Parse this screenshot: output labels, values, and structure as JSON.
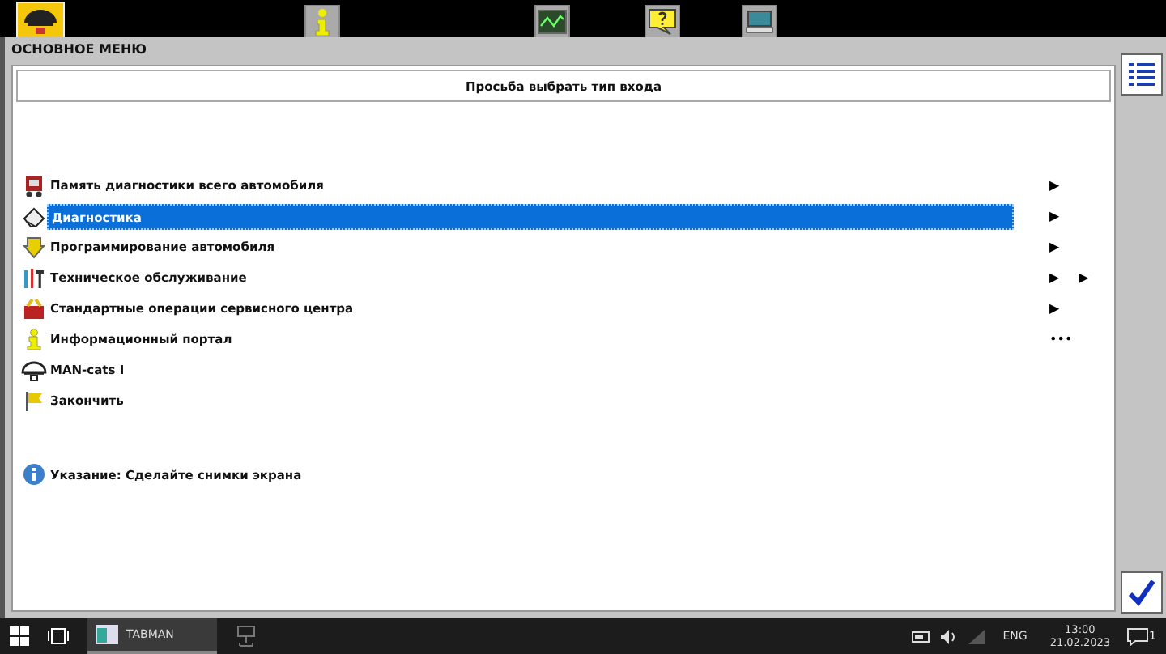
{
  "tabs": [
    {
      "kind": "home",
      "selected": true
    },
    {
      "kind": "info",
      "selected": false
    },
    {
      "kind": "chart",
      "selected": false
    },
    {
      "kind": "help",
      "selected": false
    },
    {
      "kind": "computer",
      "selected": false
    }
  ],
  "screen_title": "ОСНОВНОЕ МЕНЮ",
  "prompt": "Просьба выбрать тип входа",
  "menu": [
    {
      "kind": "memory",
      "label": "Память диагностики всего автомобиля",
      "selected": false,
      "trail": [
        "▶"
      ]
    },
    {
      "kind": "eraser",
      "label": "Диагностика",
      "selected": true,
      "trail": [
        "▶"
      ]
    },
    {
      "kind": "download",
      "label": "Программирование автомобиля",
      "selected": false,
      "trail": [
        "▶"
      ]
    },
    {
      "kind": "tools",
      "label": "Техническое обслуживание",
      "selected": false,
      "trail": [
        "▶",
        "▶"
      ]
    },
    {
      "kind": "toolbox",
      "label": "Стандартные операции сервисного центра",
      "selected": false,
      "trail": [
        "▶"
      ]
    },
    {
      "kind": "info",
      "label": "Информационный портал",
      "selected": false,
      "trail": [
        "•••"
      ]
    },
    {
      "kind": "logo",
      "label": "MAN-cats I",
      "selected": false
    },
    {
      "kind": "flag",
      "label": "Закончить",
      "selected": false
    }
  ],
  "hint": "Указание: Сделайте снимки экрана",
  "taskbar": {
    "app": "TABMAN",
    "language": "ENG",
    "time": "13:00",
    "date": "21.02.2023",
    "notifications": "1"
  }
}
